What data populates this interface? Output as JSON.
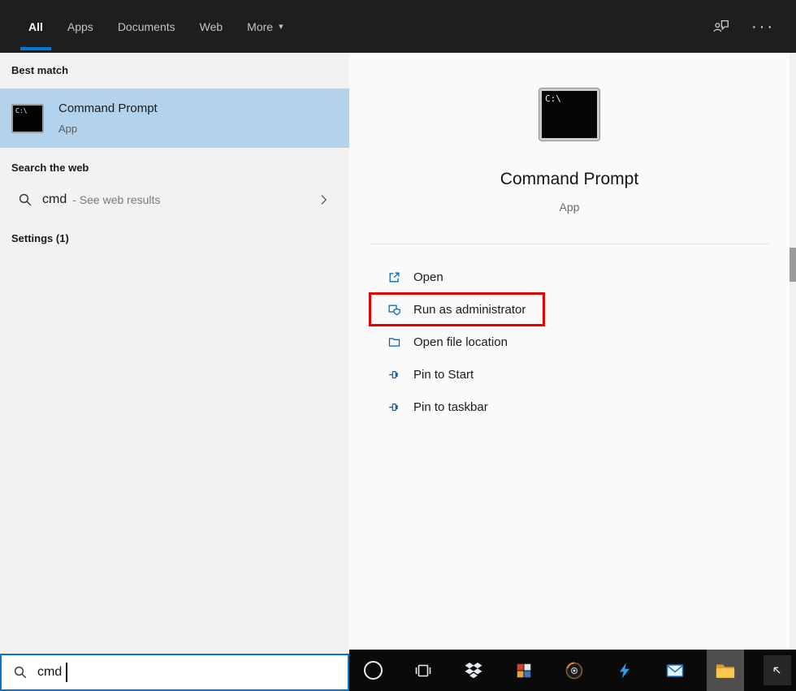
{
  "topbar": {
    "tabs": [
      {
        "label": "All",
        "active": true
      },
      {
        "label": "Apps",
        "active": false
      },
      {
        "label": "Documents",
        "active": false
      },
      {
        "label": "Web",
        "active": false
      },
      {
        "label": "More",
        "active": false,
        "has_dropdown": true
      }
    ],
    "dropdown_caret": "▾",
    "ellipsis": "···"
  },
  "left_panel": {
    "best_match_header": "Best match",
    "best_match": {
      "title": "Command Prompt",
      "subtitle": "App"
    },
    "search_web_header": "Search the web",
    "web_result": {
      "query": "cmd",
      "suffix": "- See web results"
    },
    "settings_header": "Settings (1)"
  },
  "preview": {
    "app_title": "Command Prompt",
    "app_subtitle": "App",
    "actions": [
      {
        "label": "Open",
        "icon": "open-new-window-icon",
        "highlighted": false
      },
      {
        "label": "Run as administrator",
        "icon": "admin-shield-icon",
        "highlighted": true
      },
      {
        "label": "Open file location",
        "icon": "folder-location-icon",
        "highlighted": false
      },
      {
        "label": "Pin to Start",
        "icon": "pin-icon",
        "highlighted": false
      },
      {
        "label": "Pin to taskbar",
        "icon": "pin-icon",
        "highlighted": false
      }
    ]
  },
  "search_box": {
    "value": "cmd",
    "placeholder": ""
  },
  "cmd_icon": {
    "text": "C:\\"
  },
  "icons": {
    "topbar": [
      "feedback-icon",
      "ellipsis-icon"
    ],
    "taskbar": [
      "cortana-icon",
      "task-view-icon",
      "dropbox-icon",
      "grid-app-icon",
      "lens-app-icon",
      "lightning-app-icon",
      "mail-icon",
      "file-explorer-icon",
      "tray-expand-icon"
    ]
  },
  "colors": {
    "accent_blue": "#0078d7",
    "selection_blue": "#b3d3ec",
    "action_icon_blue": "#0067b8",
    "highlight_red": "#e60000",
    "topbar_dark": "#1e1e1e",
    "taskbar_dark": "#0a0a0a"
  }
}
